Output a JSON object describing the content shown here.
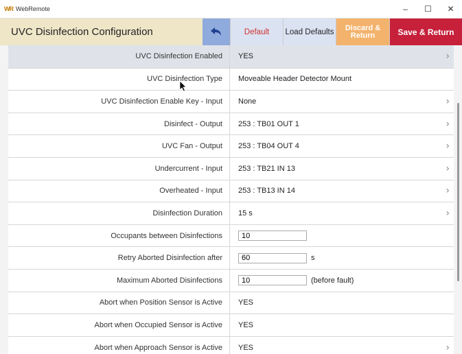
{
  "window": {
    "logo": "WR",
    "title": "WebRemote",
    "controls": [
      "–",
      "☐",
      "✕"
    ]
  },
  "header": {
    "title": "UVC Disinfection Configuration",
    "undo_icon": "undo-icon",
    "default_label": "Default",
    "load_defaults_label": "Load Defaults",
    "discard_label": "Discard & Return",
    "save_label": "Save & Return"
  },
  "colors": {
    "header_bg": "#efe6c8",
    "undo_bg": "#8faadc",
    "default_text": "#d0312d",
    "discard_bg": "#f4b36c",
    "save_bg": "#c6203a"
  },
  "rows": [
    {
      "label": "UVC Disinfection Enabled",
      "value": "YES",
      "chevron": true
    },
    {
      "label": "UVC Disinfection Type",
      "value": "Moveable Header Detector Mount",
      "chevron": false
    },
    {
      "label": "UVC Disinfection Enable Key - Input",
      "value": "None",
      "chevron": true
    },
    {
      "label": "Disinfect - Output",
      "value": "253 : TB01 OUT 1",
      "chevron": true
    },
    {
      "label": "UVC Fan - Output",
      "value": "253 : TB04 OUT 4",
      "chevron": true
    },
    {
      "label": "Undercurrent - Input",
      "value": "253 : TB21 IN 13",
      "chevron": true
    },
    {
      "label": "Overheated - Input",
      "value": "253 : TB13 IN 14",
      "chevron": true
    },
    {
      "label": "Disinfection Duration",
      "value": "15 s",
      "chevron": true
    },
    {
      "label": "Occupants between Disinfections",
      "input": "10",
      "suffix": ""
    },
    {
      "label": "Retry Aborted Disinfection after",
      "input": "60",
      "suffix": "s"
    },
    {
      "label": "Maximum Aborted Disinfections",
      "input": "10",
      "suffix": "(before fault)"
    },
    {
      "label": "Abort when Position Sensor is Active",
      "value": "YES",
      "chevron": false
    },
    {
      "label": "Abort when Occupied Sensor is Active",
      "value": "YES",
      "chevron": false
    },
    {
      "label": "Abort when Approach Sensor is Active",
      "value": "YES",
      "chevron": true
    }
  ],
  "chevron_glyph": "›"
}
